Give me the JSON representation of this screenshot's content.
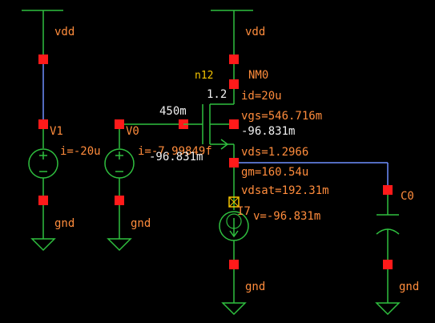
{
  "schematic": {
    "net_labels": {
      "vdd_left": "vdd",
      "vdd_right": "vdd",
      "gnd_v1": "gnd",
      "gnd_v0": "gnd",
      "gnd_mos": "gnd",
      "gnd_cap": "gnd"
    },
    "components": {
      "v1_name": "V1",
      "v1_current": "i=-20u",
      "v0_name": "V0",
      "v0_current": "i=-7.99849f",
      "nmos_name": "NM0",
      "nmos_net": "n12",
      "nmos_width": "1.2",
      "gate_voltage": "450m",
      "nmos_id": "id=20u",
      "nmos_vgs": "vgs=546.716m",
      "nmos_vs": "-96.831m",
      "gate_node_voltage": "-96.831m",
      "nmos_vds": "vds=1.2966",
      "nmos_gm": "gm=160.54u",
      "nmos_vdsat": "vdsat=192.31m",
      "isrc_name": "I7",
      "isrc_voltage": "v=-96.831m",
      "cap_name": "C0"
    },
    "colors": {
      "wire_green": "#2fbf3f",
      "wire_blue": "#6f8fff",
      "pin_red": "#ff1a1a",
      "label_orange": "#ff8c3c",
      "label_white": "#f0f0f0",
      "label_yellow": "#f5c400",
      "background": "#000000"
    }
  }
}
